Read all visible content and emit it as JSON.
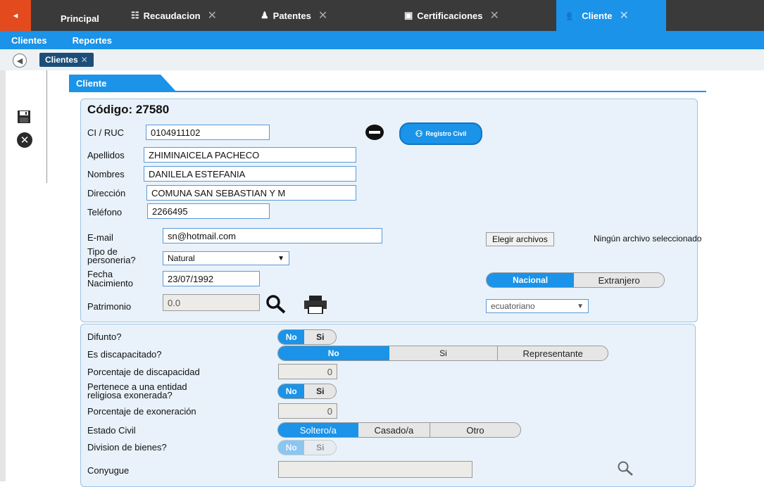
{
  "tabs": [
    {
      "label": "Principal",
      "icon": "none"
    },
    {
      "label": "Recaudacion",
      "icon": "list-icon"
    },
    {
      "label": "Patentes",
      "icon": "person-icon"
    },
    {
      "label": "Certificaciones",
      "icon": "card-icon"
    },
    {
      "label": "Cliente",
      "icon": "group-icon"
    }
  ],
  "menu": {
    "item1": "Clientes",
    "item2": "Reportes"
  },
  "breadcrumb": {
    "label": "Clientes"
  },
  "section_title": "Cliente",
  "client": {
    "codigo_label": "Código: 27580",
    "ci_label": "CI / RUC",
    "ci_value": "0104911102",
    "registro_civil": "Registro Civil",
    "apellidos_label": "Apellidos",
    "apellidos_value": "ZHIMINAICELA PACHECO",
    "nombres_label": "Nombres",
    "nombres_value": "DANILELA ESTEFANIA",
    "direccion_label": "Dirección",
    "direccion_value": "COMUNA SAN SEBASTIAN Y M",
    "telefono_label": "Teléfono",
    "telefono_value": "2266495",
    "email_label": "E-mail",
    "email_value": "sn@hotmail.com",
    "choose_file": "Elegir archivos",
    "no_file": "Ningún archivo seleccionado",
    "tipo_label_1": "Tipo de",
    "tipo_label_2": "personeria?",
    "tipo_value": "Natural",
    "fecha_label_1": "Fecha",
    "fecha_label_2": "Nacimiento",
    "fecha_value": "23/07/1992",
    "nacional": "Nacional",
    "extranjero": "Extranjero",
    "patrimonio_label": "Patrimonio",
    "patrimonio_value": "0.0",
    "nacionalidad_value": "ecuatoriano"
  },
  "details": {
    "difunto_label": "Difunto?",
    "no": "No",
    "si": "Si",
    "discapacitado_label": "Es discapacitado?",
    "representante": "Representante",
    "porc_disc_label": "Porcentaje de discapacidad",
    "porc_disc_value": "0",
    "religiosa_label_1": "Pertenece a una entidad",
    "religiosa_label_2": "religiosa exonerada?",
    "porc_exon_label": "Porcentaje de exoneración",
    "porc_exon_value": "0",
    "estado_civil_label": "Estado Civil",
    "soltero": "Soltero/a",
    "casado": "Casado/a",
    "otro": "Otro",
    "division_label": "Division de bienes?",
    "conyugue_label": "Conyugue"
  },
  "colors": {
    "accent": "#1a93e8",
    "topbar": "#3a3a3a",
    "back": "#e34b1e"
  }
}
